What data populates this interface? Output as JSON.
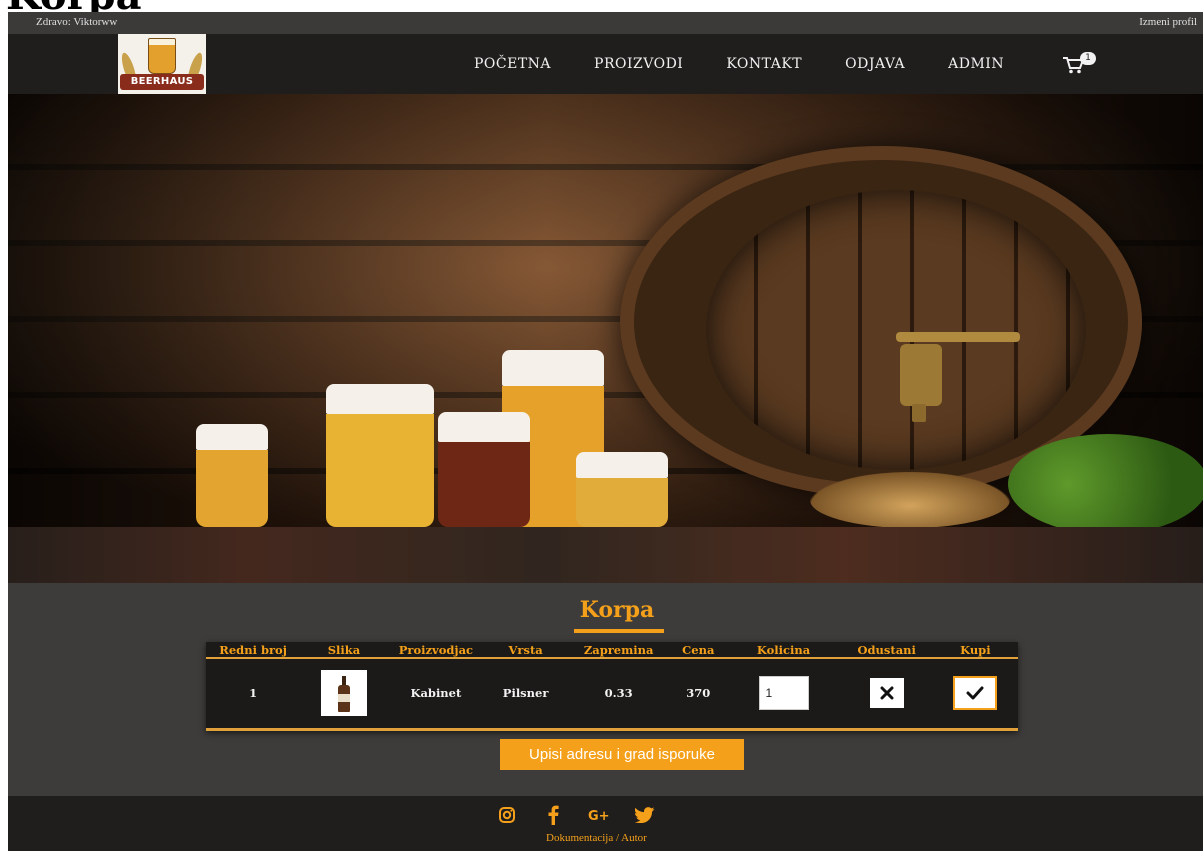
{
  "stray_heading": "Korpa",
  "topbar": {
    "greeting": "Zdravo: Viktorww",
    "edit_profile": "Izmeni profil"
  },
  "logo": {
    "text": "BEERHAUS"
  },
  "nav": {
    "items": [
      "POČETNA",
      "PROIZVODI",
      "KONTAKT",
      "ODJAVA",
      "ADMIN"
    ],
    "cart_count": "1"
  },
  "cart": {
    "title": "Korpa",
    "columns": [
      "Redni broj",
      "Slika",
      "Proizvodjac",
      "Vrsta",
      "Zapremina",
      "Cena",
      "Kolicina",
      "Odustani",
      "Kupi"
    ],
    "rows": [
      {
        "index": "1",
        "manufacturer": "Kabinet",
        "type": "Pilsner",
        "volume": "0.33",
        "price": "370",
        "quantity": "1"
      }
    ],
    "address_button": "Upisi adresu i grad isporuke"
  },
  "footer": {
    "socials": [
      "instagram-icon",
      "facebook-icon",
      "google-plus-icon",
      "twitter-icon"
    ],
    "links": "Dokumentacija / Autor"
  },
  "colors": {
    "accent": "#f5a01a",
    "topbar_bg": "#3b3a39",
    "navbar_bg": "#1f1e1d",
    "main_bg": "#3d3c3a",
    "table_bg": "#1b1a18"
  }
}
